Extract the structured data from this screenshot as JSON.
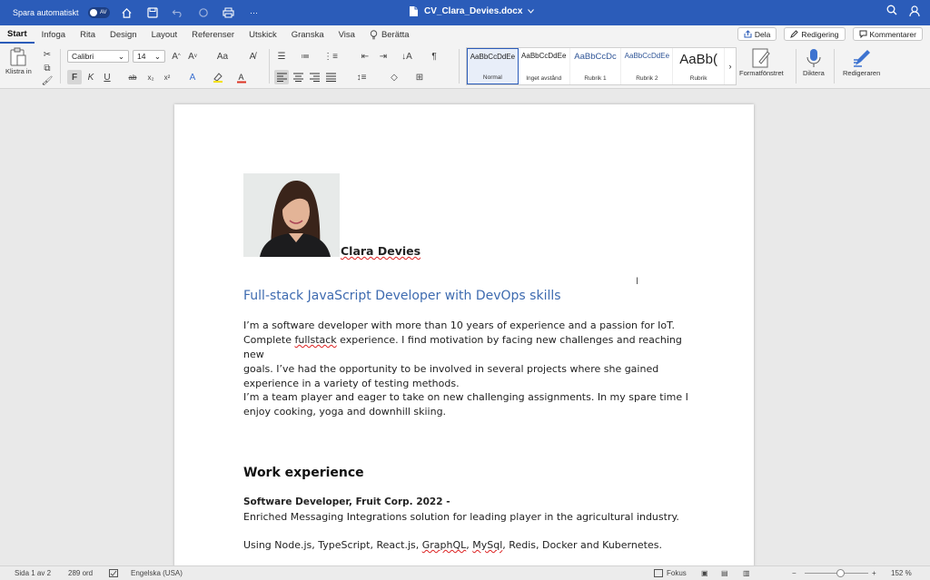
{
  "titlebar": {
    "autosave_label": "Spara automatiskt",
    "autosave_state": "AV",
    "filename": "CV_Clara_Devies.docx"
  },
  "tabs": [
    "Start",
    "Infoga",
    "Rita",
    "Design",
    "Layout",
    "Referenser",
    "Utskick",
    "Granska",
    "Visa",
    "Berätta"
  ],
  "share": {
    "dela": "Dela",
    "redigering": "Redigering",
    "kommentarer": "Kommentarer"
  },
  "ribbon": {
    "paste": "Klistra in",
    "font": "Calibri",
    "size": "14",
    "bold": "F",
    "italic": "K",
    "underline": "U",
    "styles": [
      {
        "sample": "AaBbCcDdEe",
        "name": "Normal"
      },
      {
        "sample": "AaBbCcDdEe",
        "name": "Inget avstånd"
      },
      {
        "sample": "AaBbCcDc",
        "name": "Rubrik 1"
      },
      {
        "sample": "AaBbCcDdEe",
        "name": "Rubrik 2"
      },
      {
        "sample": "AaBb(",
        "name": "Rubrik"
      }
    ],
    "format_pane": "Formatfönstret",
    "dictate": "Diktera",
    "editor": "Redigeraren"
  },
  "document": {
    "name": "Clara Devies",
    "headline": "Full-stack JavaScript Developer with DevOps skills",
    "para1_a": "I’m a software developer with more than 10 years of experience and a passion for IoT.",
    "para1_b1": "Complete ",
    "para1_b_err": "fullstack",
    "para1_b2": " experience. I find motivation by facing new challenges and reaching new",
    "para1_c": "goals. I’ve had the opportunity to be involved in several projects where she gained",
    "para1_d": "experience in a variety of testing methods.",
    "para2_a": "I’m a team player and eager to take on new challenging assignments. In my spare time I",
    "para2_b": "enjoy cooking, yoga and downhill skiing.",
    "work_heading": "Work experience",
    "job_title": "Software Developer, Fruit Corp. 2022 -",
    "job_desc": "Enriched Messaging Integrations solution for leading player in the agricultural industry.",
    "tech_a": "Using Node.js, TypeScript, React.js, ",
    "tech_err1": "GraphQL",
    "tech_b": ", ",
    "tech_err2": "MySql",
    "tech_c": ", Redis, Docker and Kubernetes."
  },
  "statusbar": {
    "page": "Sida 1 av 2",
    "words": "289 ord",
    "language": "Engelska (USA)",
    "focus": "Fokus",
    "zoom": "152 %"
  }
}
